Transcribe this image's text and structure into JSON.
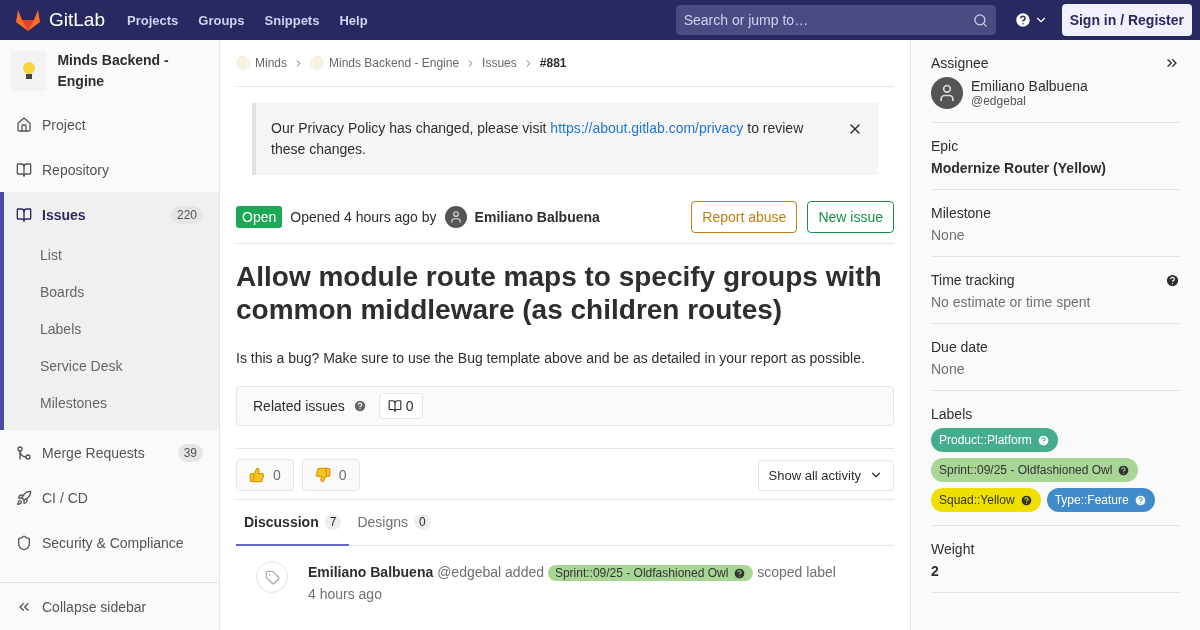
{
  "header": {
    "logo": "GitLab",
    "nav": [
      "Projects",
      "Groups",
      "Snippets",
      "Help"
    ],
    "search": {
      "placeholder": "Search or jump to…"
    },
    "signin": "Sign in / Register"
  },
  "sidebar": {
    "project": "Minds Backend - Engine",
    "items": [
      {
        "kind": "project",
        "label": "Project",
        "selected": false
      },
      {
        "kind": "repository",
        "label": "Repository",
        "selected": false
      },
      {
        "kind": "issues",
        "label": "Issues",
        "count": "220",
        "selected": true,
        "children": [
          {
            "label": "List"
          },
          {
            "label": "Boards"
          },
          {
            "label": "Labels"
          },
          {
            "label": "Service Desk"
          },
          {
            "label": "Milestones"
          }
        ]
      },
      {
        "kind": "merge",
        "label": "Merge Requests",
        "count": "39",
        "selected": false
      },
      {
        "kind": "cicd",
        "label": "CI / CD",
        "selected": false
      },
      {
        "kind": "security",
        "label": "Security & Compliance",
        "selected": false
      }
    ],
    "collapse": "Collapse sidebar"
  },
  "breadcrumbs": [
    "Minds",
    "Minds Backend - Engine",
    "Issues",
    "#881"
  ],
  "notice": {
    "text": "Our Privacy Policy has changed, please visit",
    "link": "https://about.gitlab.com/privacy",
    "text_after": "to review these changes."
  },
  "issue": {
    "status": "Open",
    "opened": "Opened 4 hours ago by",
    "author": "Emiliano Balbuena",
    "buttons": [
      {
        "kind": "warning",
        "label": "Report abuse"
      },
      {
        "kind": "success",
        "label": "New issue"
      }
    ],
    "title": "Allow module route maps to specify groups with common middleware (as children routes)",
    "description": "Is this a bug? Make sure to use the Bug template above and be as detailed in your report as possible.",
    "related": {
      "label": "Related issues",
      "count": "0"
    },
    "reactions": [
      {
        "kind": "up",
        "count": "0"
      },
      {
        "kind": "down",
        "count": "0"
      }
    ],
    "activity_filter": "Show all activity",
    "tabs": [
      {
        "label": "Discussion",
        "count": "7",
        "selected": true
      },
      {
        "label": "Designs",
        "count": "0",
        "selected": false
      }
    ],
    "note": {
      "author": "Emiliano Balbuena",
      "handle": "@edgebal",
      "action": "added",
      "label": {
        "text": "Sprint::09/25 - Oldfashioned Owl",
        "color": "#a8d695"
      },
      "suffix": "scoped label",
      "time": "4 hours ago"
    }
  },
  "right_sidebar": {
    "assignee": {
      "title": "Assignee",
      "name": "Emiliano Balbuena",
      "handle": "@edgebal"
    },
    "sections": [
      {
        "kind": "bold",
        "title": "Epic",
        "value": "Modernize Router (Yellow)"
      },
      {
        "kind": "muted",
        "title": "Milestone",
        "value": "None"
      },
      {
        "kind": "help",
        "title": "Time tracking",
        "value": "No estimate or time spent"
      },
      {
        "kind": "muted",
        "title": "Due date",
        "value": "None"
      }
    ],
    "labels": {
      "title": "Labels",
      "items": [
        {
          "text": "Product::Platform",
          "color": "#44ad8e"
        },
        {
          "text": "Sprint::09/25 - Oldfashioned Owl",
          "color": "#a8d695"
        },
        {
          "text": "Squad::Yellow",
          "color": "#f0e000"
        },
        {
          "text": "Type::Feature",
          "color": "#428bca"
        }
      ]
    },
    "weight": {
      "title": "Weight",
      "value": "2"
    }
  }
}
